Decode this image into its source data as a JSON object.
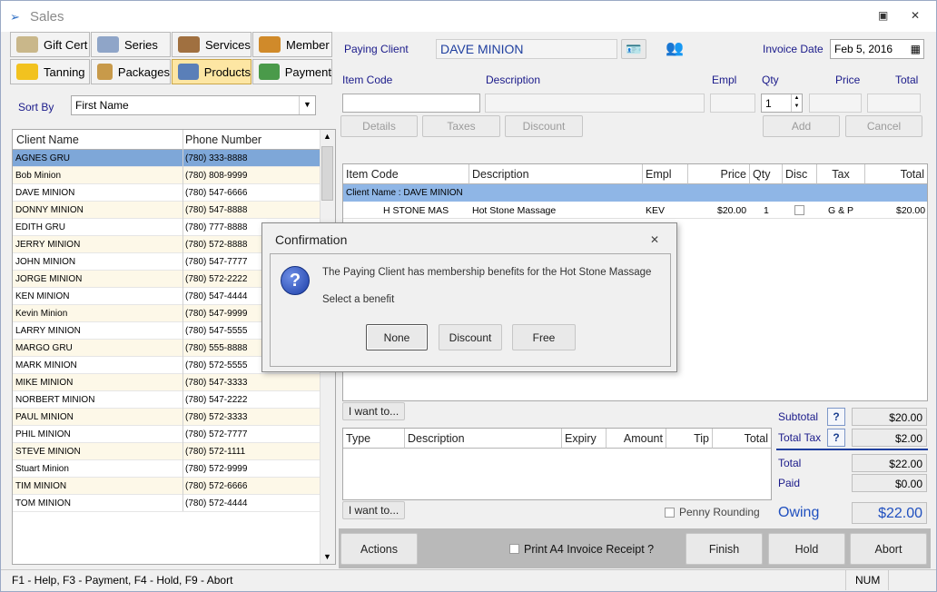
{
  "window": {
    "title": "Sales"
  },
  "tabs": [
    {
      "label": "Gift Cert",
      "icon": "gift-cert-icon",
      "color": "#c9b78a"
    },
    {
      "label": "Series",
      "icon": "series-icon",
      "color": "#8fa5c8"
    },
    {
      "label": "Services",
      "icon": "services-icon",
      "color": "#a07040"
    },
    {
      "label": "Member",
      "icon": "member-icon",
      "color": "#d08a2a"
    },
    {
      "label": "Tanning",
      "icon": "tanning-icon",
      "color": "#f2c21f"
    },
    {
      "label": "Packages",
      "icon": "packages-icon",
      "color": "#c89a4a"
    },
    {
      "label": "Products",
      "icon": "products-icon",
      "color": "#5a7fb8"
    },
    {
      "label": "Payment",
      "icon": "payment-icon",
      "color": "#4a9a4a"
    }
  ],
  "sort": {
    "label": "Sort By",
    "value": "First Name"
  },
  "clients": {
    "headers": [
      "Client Name",
      "Phone Number"
    ],
    "rows": [
      [
        "AGNES GRU",
        "(780) 333-8888"
      ],
      [
        "Bob Minion",
        "(780) 808-9999"
      ],
      [
        "DAVE MINION",
        "(780) 547-6666"
      ],
      [
        "DONNY MINION",
        "(780) 547-8888"
      ],
      [
        "EDITH GRU",
        "(780) 777-8888"
      ],
      [
        "JERRY MINION",
        "(780) 572-8888"
      ],
      [
        "JOHN MINION",
        "(780) 547-7777"
      ],
      [
        "JORGE MINION",
        "(780) 572-2222"
      ],
      [
        "KEN MINION",
        "(780) 547-4444"
      ],
      [
        "Kevin Minion",
        "(780) 547-9999"
      ],
      [
        "LARRY MINION",
        "(780) 547-5555"
      ],
      [
        "MARGO GRU",
        "(780) 555-8888"
      ],
      [
        "MARK MINION",
        "(780) 572-5555"
      ],
      [
        "MIKE MINION",
        "(780) 547-3333"
      ],
      [
        "NORBERT MINION",
        "(780) 547-2222"
      ],
      [
        "PAUL MINION",
        "(780) 572-3333"
      ],
      [
        "PHIL MINION",
        "(780) 572-7777"
      ],
      [
        "STEVE MINION",
        "(780) 572-1111"
      ],
      [
        "Stuart Minion",
        "(780) 572-9999"
      ],
      [
        "TIM MINION",
        "(780) 572-6666"
      ],
      [
        "TOM MINION",
        "(780) 572-4444"
      ]
    ]
  },
  "paying": {
    "label": "Paying Client",
    "value": "DAVE MINION"
  },
  "invoice": {
    "label": "Invoice Date",
    "value": "Feb 5, 2016"
  },
  "entry": {
    "item_code": "Item Code",
    "description": "Description",
    "empl": "Empl",
    "qty": "Qty",
    "qty_value": "1",
    "price": "Price",
    "total": "Total"
  },
  "buttons": {
    "details": "Details",
    "taxes": "Taxes",
    "discount": "Discount",
    "add": "Add",
    "cancel": "Cancel",
    "i_want_to": "I want to...",
    "actions": "Actions",
    "finish": "Finish",
    "hold": "Hold",
    "abort": "Abort"
  },
  "items": {
    "headers": [
      "Item Code",
      "Description",
      "Empl",
      "Price",
      "Qty",
      "Disc",
      "Tax",
      "Total"
    ],
    "group": "Client Name : DAVE MINION",
    "rows": [
      {
        "code": "H STONE MAS",
        "description": "Hot Stone Massage",
        "empl": "KEV",
        "price": "$20.00",
        "qty": "1",
        "tax": "G & P",
        "total": "$20.00"
      }
    ]
  },
  "payments": {
    "headers": [
      "Type",
      "Description",
      "Expiry",
      "Amount",
      "Tip",
      "Total"
    ]
  },
  "totals": {
    "subtotal_label": "Subtotal",
    "subtotal": "$20.00",
    "tax_label": "Total Tax",
    "tax": "$2.00",
    "total_label": "Total",
    "total": "$22.00",
    "paid_label": "Paid",
    "paid": "$0.00",
    "owing_label": "Owing",
    "owing": "$22.00",
    "help": "?"
  },
  "penny_rounding": "Penny Rounding",
  "print_a4": "Print A4 Invoice Receipt ?",
  "status": {
    "help": "F1 - Help, F3 - Payment, F4 - Hold, F9 - Abort",
    "num": "NUM"
  },
  "dialog": {
    "title": "Confirmation",
    "message": "The Paying Client has membership benefits for the Hot Stone Massage",
    "prompt": "Select a benefit",
    "none": "None",
    "discount": "Discount",
    "free": "Free"
  },
  "colors": {
    "selected_row": "#7ea7d8",
    "group_row": "#8fb6e6",
    "owing": "#1f4fbf",
    "label_blue": "#1a1a8a",
    "active_tab": "#fde6a3"
  }
}
